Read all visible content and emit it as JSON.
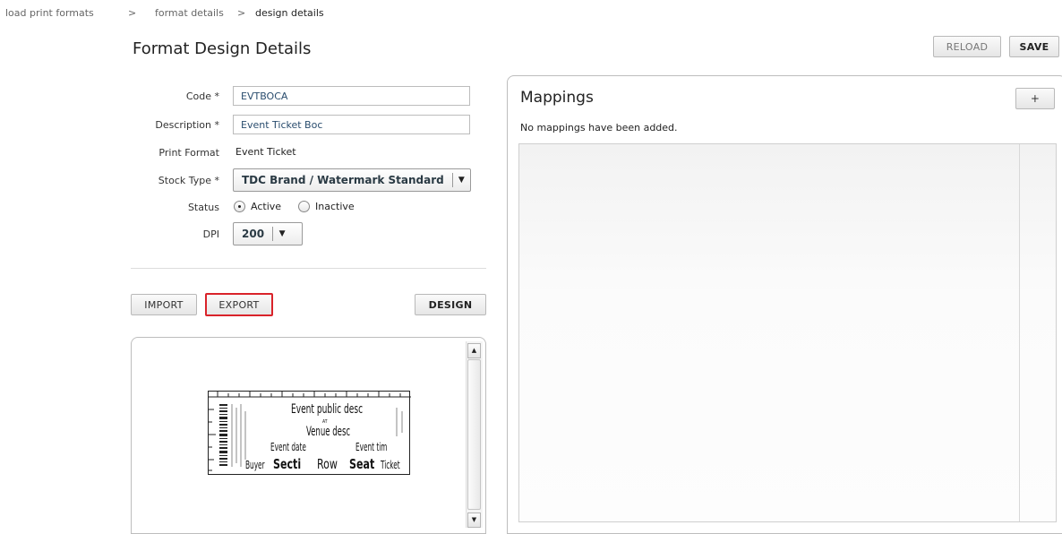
{
  "breadcrumb": {
    "items": [
      "load print formats",
      "format details",
      "design details"
    ],
    "separator": ">"
  },
  "page": {
    "title": "Format Design Details"
  },
  "toolbar": {
    "reload_label": "RELOAD",
    "save_label": "SAVE"
  },
  "form": {
    "code": {
      "label": "Code *",
      "value": "EVTBOCA"
    },
    "description": {
      "label": "Description *",
      "value": "Event Ticket Boc"
    },
    "print_format": {
      "label": "Print Format",
      "value": "Event Ticket"
    },
    "stock_type": {
      "label": "Stock Type *",
      "value": "TDC Brand / Watermark Standard"
    },
    "status": {
      "label": "Status",
      "options": [
        "Active",
        "Inactive"
      ],
      "selected": "Active"
    },
    "dpi": {
      "label": "DPI",
      "value": "200"
    }
  },
  "actions": {
    "import_label": "IMPORT",
    "export_label": "EXPORT",
    "design_label": "DESIGN"
  },
  "preview": {
    "event_title": "Event public desc",
    "at_label": "AT",
    "venue": "Venue desc",
    "event_date": "Event date",
    "event_time": "Event tim",
    "buyer": "Buyer",
    "section": "Secti",
    "row": "Row",
    "seat": "Seat",
    "ticket": "Ticket"
  },
  "mappings": {
    "title": "Mappings",
    "add_label": "+",
    "empty_message": "No mappings have been added."
  },
  "colors": {
    "highlight": "#d9232a",
    "border": "#bdbdbd",
    "link": "#2a4d6e"
  }
}
